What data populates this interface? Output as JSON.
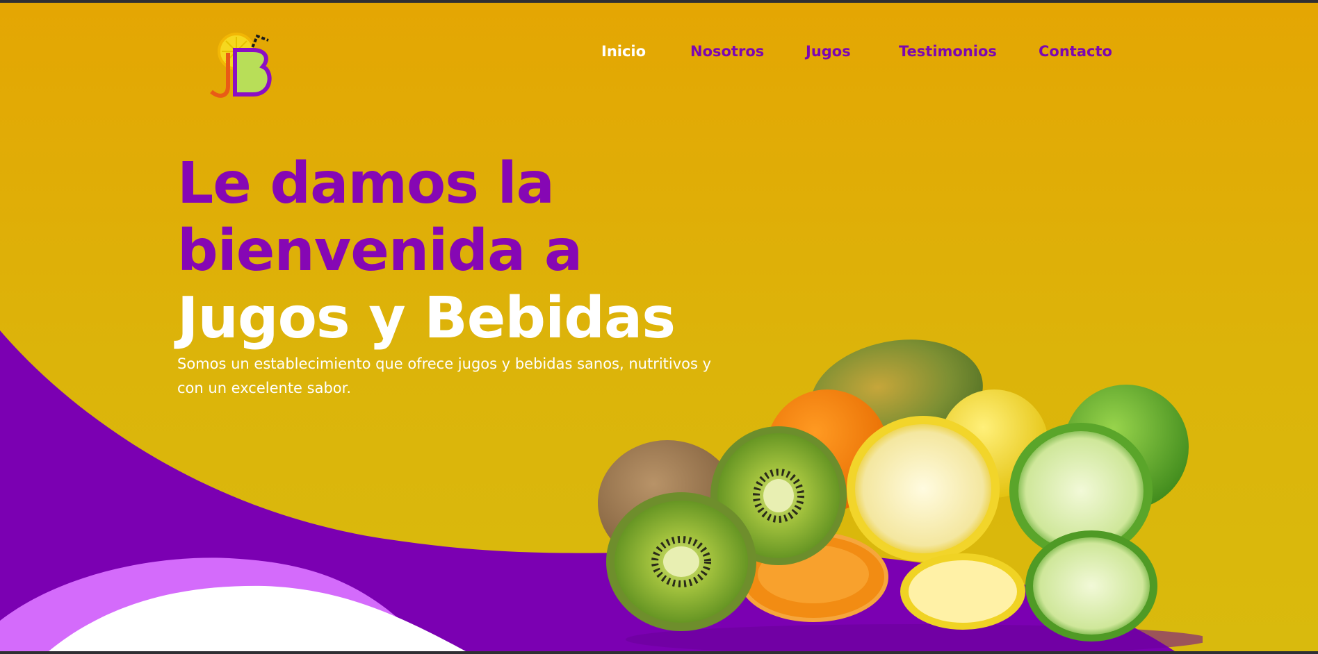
{
  "brand": {
    "logo_text": "JB",
    "logo_alt": "Jugos y Bebidas logo"
  },
  "nav": {
    "items": [
      {
        "label": "Inicio",
        "active": true
      },
      {
        "label": "Nosotros",
        "active": false
      },
      {
        "label": "Jugos",
        "active": false
      },
      {
        "label": "Testimonios",
        "active": false
      },
      {
        "label": "Contacto",
        "active": false
      }
    ]
  },
  "hero": {
    "title_line1": "Le damos la",
    "title_line2": "bienvenida a",
    "title_line3": "Jugos y Bebidas",
    "subtitle": "Somos un establecimiento que ofrece jugos y bebidas sanos, nutritivos y con un excelente sabor.",
    "image": "fruits-image"
  },
  "colors": {
    "background_top": "#e4a603",
    "background_bottom": "#d9ba0d",
    "purple": "#7b00b2",
    "light_purple": "#d46bfb",
    "title_purple": "#8607b4",
    "white": "#ffffff"
  }
}
